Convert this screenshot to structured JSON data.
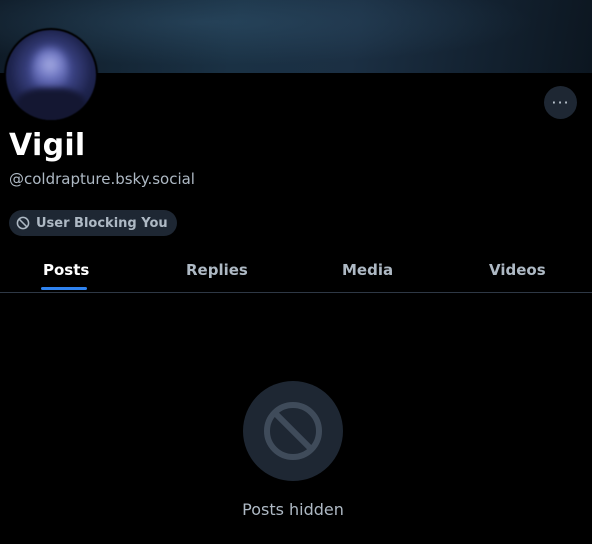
{
  "profile": {
    "display_name": "Vigil",
    "handle": "@coldrapture.bsky.social",
    "more_label": "···",
    "badge_label": "User Blocking You",
    "badge_icon": "block-icon"
  },
  "tabs": [
    {
      "label": "Posts",
      "active": true
    },
    {
      "label": "Replies",
      "active": false
    },
    {
      "label": "Media",
      "active": false
    },
    {
      "label": "Videos",
      "active": false
    }
  ],
  "empty_state": {
    "icon": "block-icon",
    "message": "Posts hidden"
  },
  "colors": {
    "background": "#000000",
    "accent": "#2f83f0",
    "muted_text": "#aeb9c4",
    "chip_bg": "#1e2733"
  }
}
